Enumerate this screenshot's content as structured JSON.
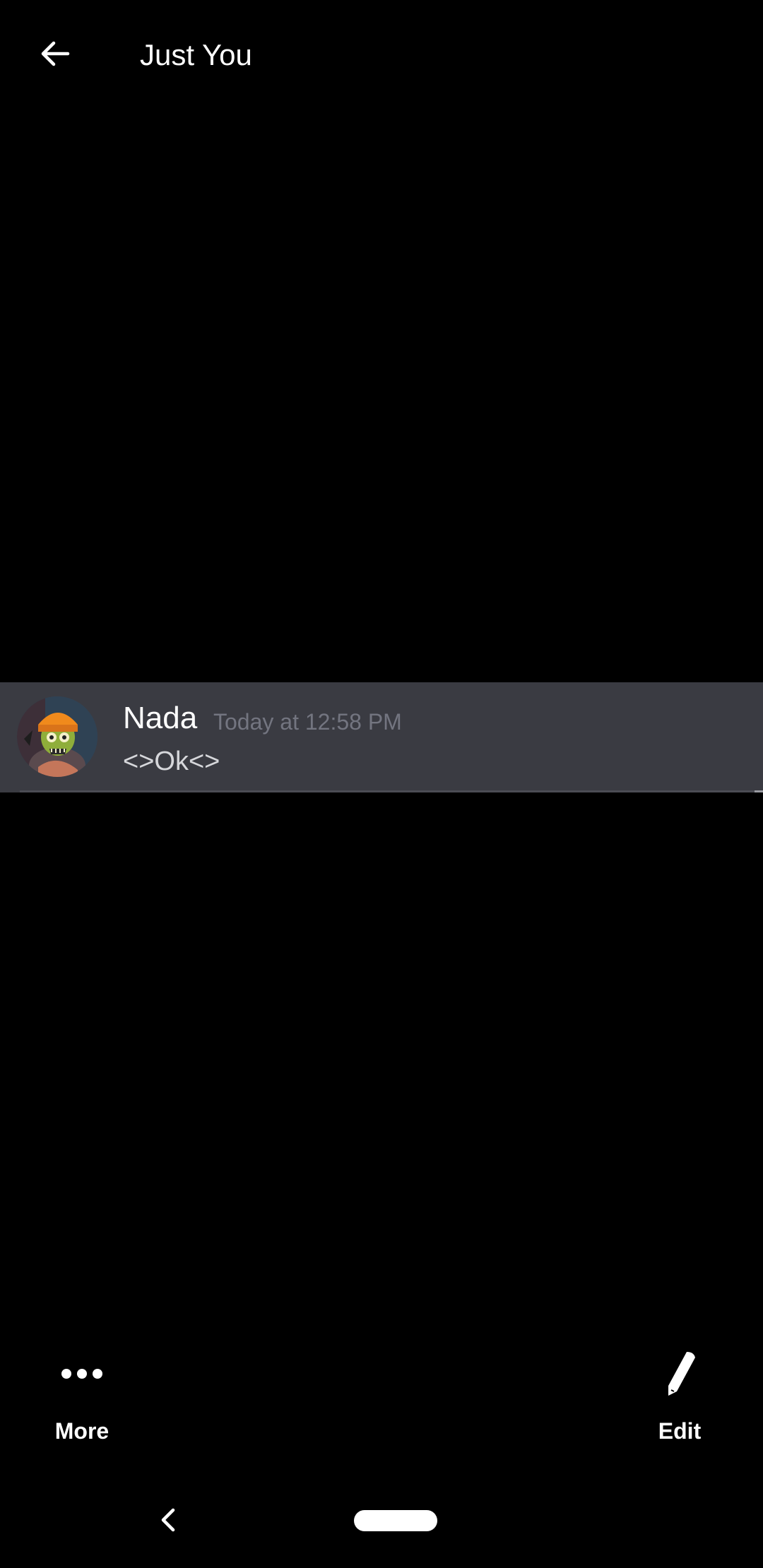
{
  "header": {
    "title": "Just You",
    "back_icon": "arrow-left-icon"
  },
  "message": {
    "author": "Nada",
    "timestamp": "Today at 12:58 PM",
    "text": "<>Ok<>",
    "avatar_icon": "avatar-zombie-character"
  },
  "actions": {
    "more": {
      "label": "More",
      "icon": "more-dots-icon"
    },
    "edit": {
      "label": "Edit",
      "icon": "pencil-icon"
    }
  },
  "nav": {
    "back_icon": "nav-back-chevron-icon",
    "home_icon": "nav-home-pill-icon"
  },
  "colors": {
    "background": "#000000",
    "message_highlight": "#3a3b42",
    "timestamp": "#737580",
    "text": "#ffffff"
  }
}
